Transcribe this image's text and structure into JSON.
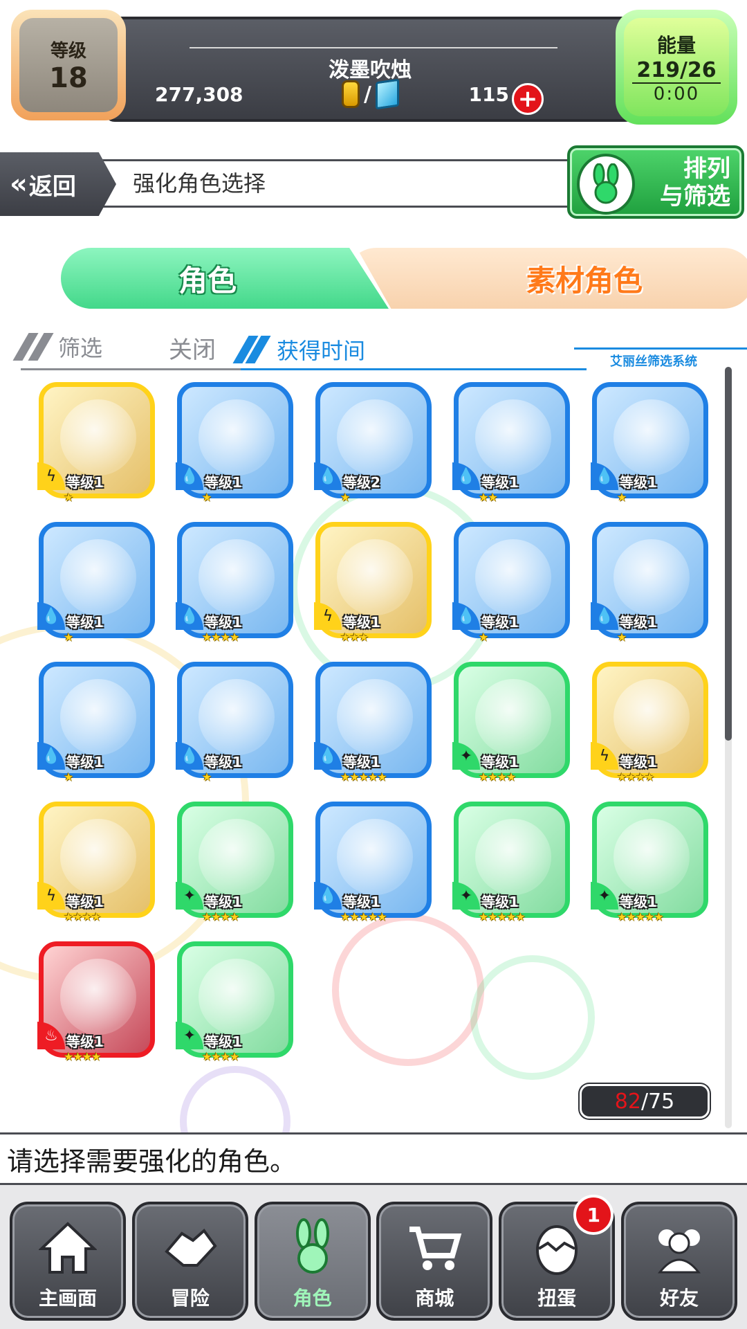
{
  "header": {
    "level_label": "等级",
    "level_value": "18",
    "player_name": "泼墨吹烛",
    "gold": "277,308",
    "currency_separator": "/",
    "gems": "115",
    "add_label": "+",
    "energy_label": "能量",
    "energy_value": "219/26",
    "energy_timer": "0:00"
  },
  "nav": {
    "back_label": "返回",
    "back_icon": "«",
    "page_title": "强化角色选择",
    "sort_label_line1": "排列",
    "sort_label_line2": "与筛选"
  },
  "tabs": {
    "character": "角色",
    "material": "素材角色"
  },
  "filter": {
    "filter_label": "筛选",
    "filter_value": "关闭",
    "sort_value": "获得时间",
    "system_label": "艾丽丝筛选系统"
  },
  "colors": {
    "water": "#1f7fe5",
    "thunder": "#ffd21a",
    "wood": "#2fd86a",
    "fire": "#ee1c24"
  },
  "level_prefix": "等级",
  "characters": [
    {
      "frame": "yellow",
      "element": "thunder",
      "level": "1",
      "stars": 1
    },
    {
      "frame": "blue",
      "element": "water",
      "level": "1",
      "stars": 1
    },
    {
      "frame": "blue",
      "element": "water",
      "level": "2",
      "stars": 1
    },
    {
      "frame": "blue",
      "element": "water",
      "level": "1",
      "stars": 2
    },
    {
      "frame": "blue",
      "element": "water",
      "level": "1",
      "stars": 1
    },
    {
      "frame": "blue",
      "element": "water",
      "level": "1",
      "stars": 1
    },
    {
      "frame": "blue",
      "element": "water",
      "level": "1",
      "stars": 4
    },
    {
      "frame": "yellow",
      "element": "thunder",
      "level": "1",
      "stars": 3
    },
    {
      "frame": "blue",
      "element": "water",
      "level": "1",
      "stars": 1
    },
    {
      "frame": "blue",
      "element": "water",
      "level": "1",
      "stars": 1
    },
    {
      "frame": "blue",
      "element": "water",
      "level": "1",
      "stars": 1
    },
    {
      "frame": "blue",
      "element": "water",
      "level": "1",
      "stars": 1
    },
    {
      "frame": "blue",
      "element": "water",
      "level": "1",
      "stars": 5
    },
    {
      "frame": "green",
      "element": "wood",
      "level": "1",
      "stars": 4
    },
    {
      "frame": "yellow",
      "element": "thunder",
      "level": "1",
      "stars": 4
    },
    {
      "frame": "yellow",
      "element": "thunder",
      "level": "1",
      "stars": 4
    },
    {
      "frame": "green",
      "element": "wood",
      "level": "1",
      "stars": 4
    },
    {
      "frame": "blue",
      "element": "water",
      "level": "1",
      "stars": 5
    },
    {
      "frame": "green",
      "element": "wood",
      "level": "1",
      "stars": 5
    },
    {
      "frame": "green",
      "element": "wood",
      "level": "1",
      "stars": 5
    },
    {
      "frame": "red",
      "element": "fire",
      "level": "1",
      "stars": 4
    },
    {
      "frame": "green",
      "element": "wood",
      "level": "1",
      "stars": 4
    }
  ],
  "count": {
    "current": "82",
    "max": "/75"
  },
  "message": "请选择需要强化的角色。",
  "bottom_nav": [
    {
      "label": "主画面",
      "icon": "home-icon",
      "active": false,
      "badge": ""
    },
    {
      "label": "冒险",
      "icon": "handshake-icon",
      "active": false,
      "badge": ""
    },
    {
      "label": "角色",
      "icon": "rabbit-icon",
      "active": true,
      "badge": ""
    },
    {
      "label": "商城",
      "icon": "cart-icon",
      "active": false,
      "badge": ""
    },
    {
      "label": "扭蛋",
      "icon": "egg-icon",
      "active": false,
      "badge": "1"
    },
    {
      "label": "好友",
      "icon": "friends-icon",
      "active": false,
      "badge": ""
    }
  ]
}
